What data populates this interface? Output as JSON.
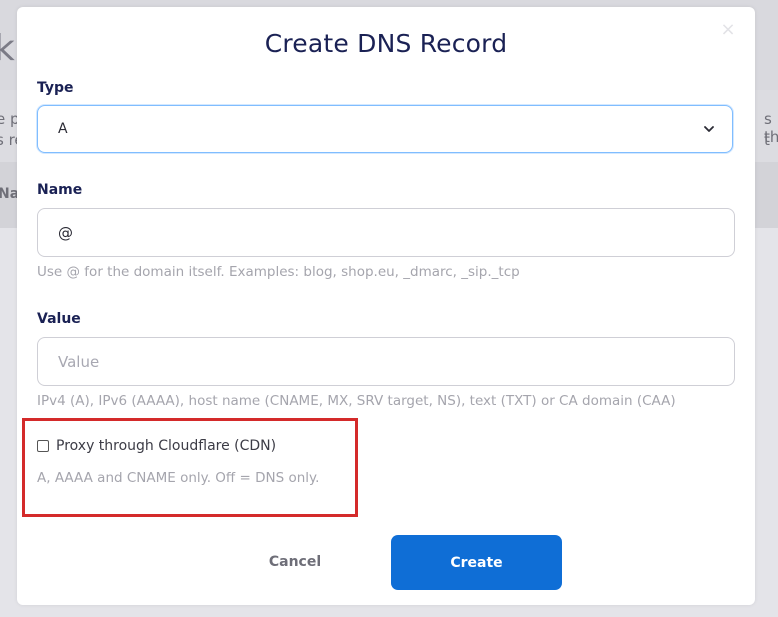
{
  "background": {
    "title_fragment": "k",
    "left_text_line1": "e p",
    "left_text_line2": "s re",
    "right_text_line1": "s th",
    "right_text_line2": "t",
    "column_fragment": "Na"
  },
  "modal": {
    "title": "Create DNS Record",
    "close_label": "×",
    "type": {
      "label": "Type",
      "selected": "A"
    },
    "name": {
      "label": "Name",
      "value": "@",
      "help": "Use @ for the domain itself. Examples: blog, shop.eu, _dmarc, _sip._tcp"
    },
    "value": {
      "label": "Value",
      "value": "",
      "placeholder": "Value",
      "help": "IPv4 (A), IPv6 (AAAA), host name (CNAME, MX, SRV target, NS), text (TXT) or CA domain (CAA)"
    },
    "proxy": {
      "label": "Proxy through Cloudflare (CDN)",
      "checked": false,
      "help": "A, AAAA and CNAME only. Off = DNS only."
    },
    "actions": {
      "cancel_label": "Cancel",
      "create_label": "Create"
    }
  },
  "colors": {
    "title": "#1a2154",
    "primary_button": "#0f6ed6",
    "focus_border": "#80bdff",
    "highlight": "#d42a2a",
    "help_text": "#a5a5ad"
  }
}
